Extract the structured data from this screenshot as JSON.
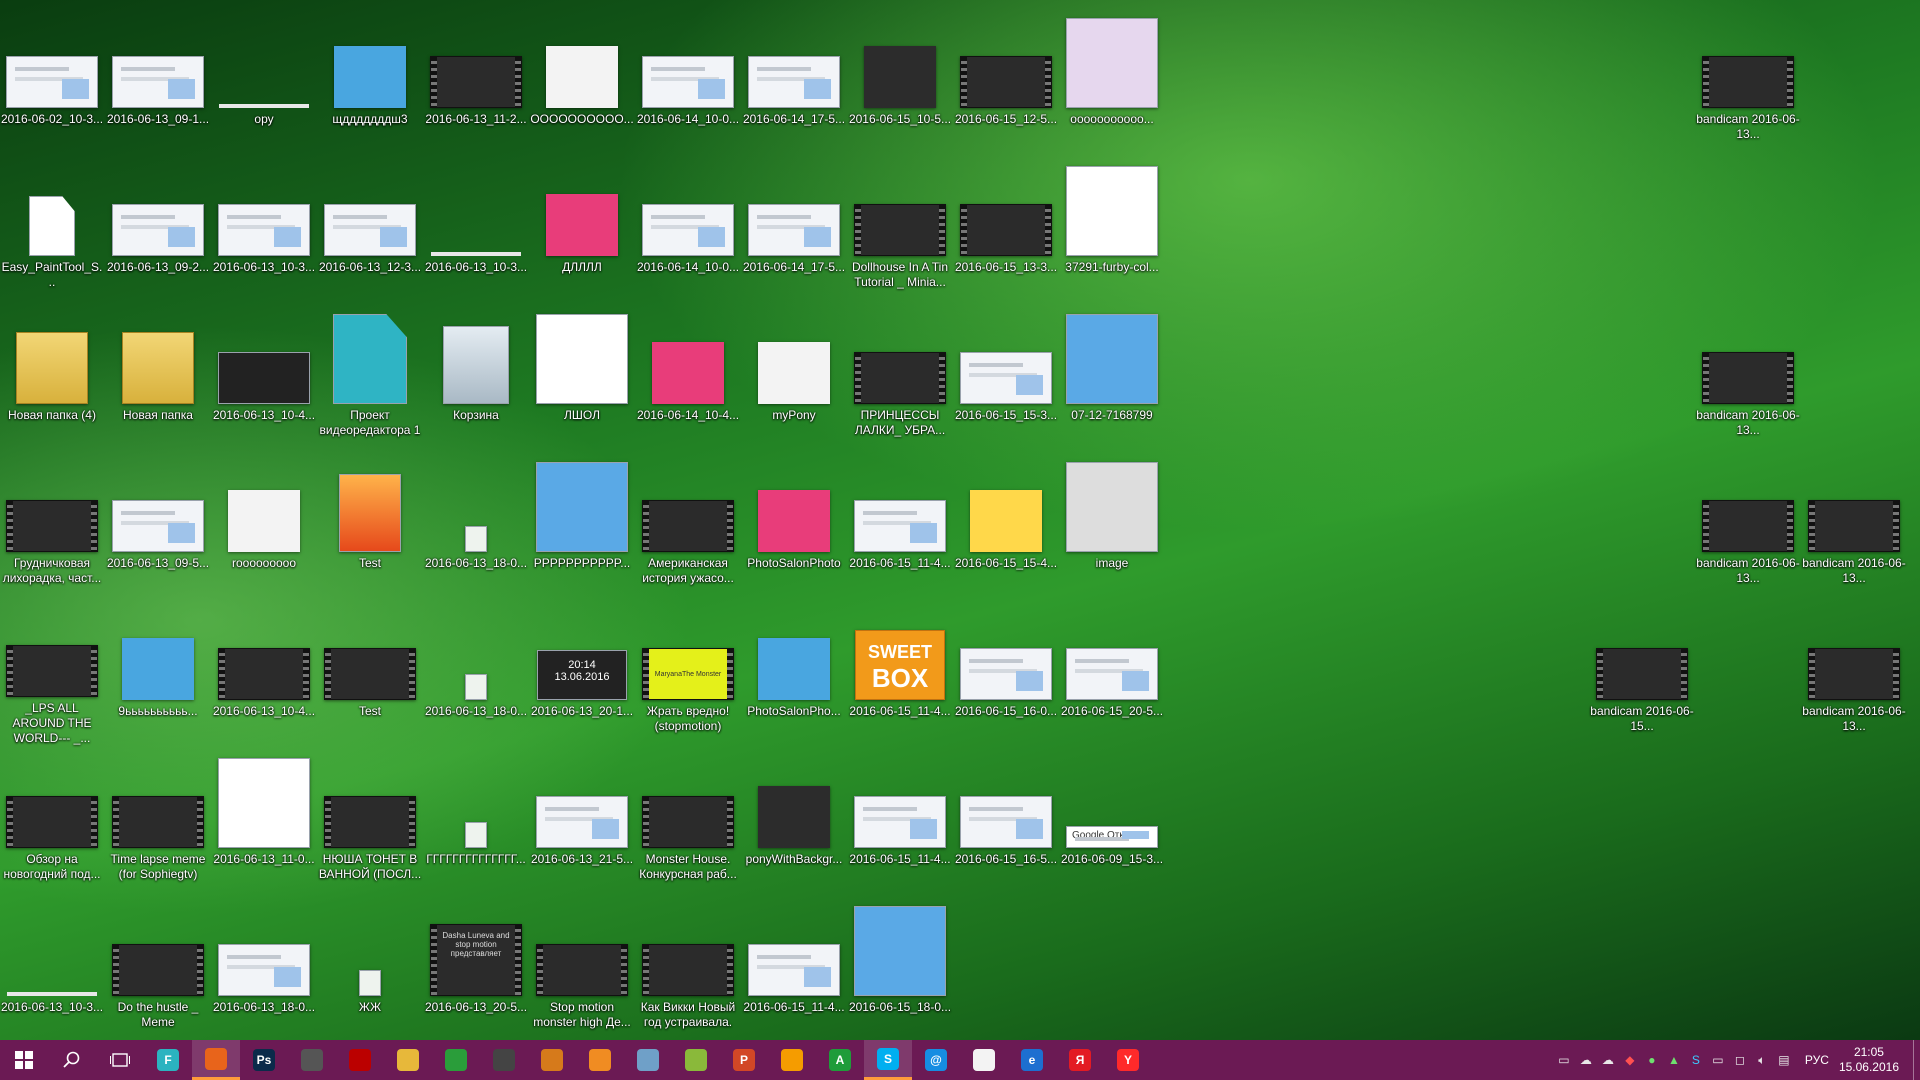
{
  "desktop_icons": [
    {
      "label": "2016-06-02_10-3...",
      "type": "shot"
    },
    {
      "label": "2016-06-13_09-1...",
      "type": "shot"
    },
    {
      "label": "ору",
      "type": "none"
    },
    {
      "label": "щдддддддш3",
      "type": "image"
    },
    {
      "label": "2016-06-13_11-2...",
      "type": "video"
    },
    {
      "label": "ОООООООООО...",
      "type": "image"
    },
    {
      "label": "2016-06-14_10-0...",
      "type": "shot"
    },
    {
      "label": "2016-06-14_17-5...",
      "type": "shot"
    },
    {
      "label": "2016-06-15_10-5...",
      "type": "image"
    },
    {
      "label": "2016-06-15_12-5...",
      "type": "video"
    },
    {
      "label": "ооооооооооо...",
      "type": "tall"
    },
    {
      "label": "Easy_PaintTool_S...",
      "type": "file"
    },
    {
      "label": "2016-06-13_09-2...",
      "type": "shot"
    },
    {
      "label": "2016-06-13_10-3...",
      "type": "shot"
    },
    {
      "label": "2016-06-13_12-3...",
      "type": "shot"
    },
    {
      "label": "2016-06-13_10-3...",
      "type": "none"
    },
    {
      "label": "ДЛЛЛЛ",
      "type": "image"
    },
    {
      "label": "2016-06-14_10-0...",
      "type": "shot"
    },
    {
      "label": "2016-06-14_17-5...",
      "type": "shot"
    },
    {
      "label": "Dollhouse In A Tin Tutorial _ Minia...",
      "type": "video"
    },
    {
      "label": "2016-06-15_13-3...",
      "type": "video"
    },
    {
      "label": "37291-furby-col...",
      "type": "tall"
    },
    {
      "label": "Новая папка (4)",
      "type": "folder"
    },
    {
      "label": "Новая папка",
      "type": "folder"
    },
    {
      "label": "2016-06-13_10-4...",
      "type": "dark"
    },
    {
      "label": "Проект видеоредактора 1",
      "type": "file"
    },
    {
      "label": "Корзина",
      "type": "bin"
    },
    {
      "label": "ЛШОЛ",
      "type": "tall"
    },
    {
      "label": "2016-06-14_10-4...",
      "type": "image"
    },
    {
      "label": "myPony",
      "type": "image"
    },
    {
      "label": "ПРИНЦЕССЫ ЛАЛКИ_ УБРА...",
      "type": "video"
    },
    {
      "label": "2016-06-15_15-3...",
      "type": "shot"
    },
    {
      "label": "07-12-7168799",
      "type": "tall"
    },
    {
      "label": "Грудничковая лихорадка, част...",
      "type": "video"
    },
    {
      "label": "2016-06-13_09-5...",
      "type": "shot"
    },
    {
      "label": "rooooooooo",
      "type": "image"
    },
    {
      "label": "Test",
      "type": "firefox"
    },
    {
      "label": "2016-06-13_18-0...",
      "type": "small"
    },
    {
      "label": "PPPPPPPPPPP...",
      "type": "tall"
    },
    {
      "label": "Американская история ужасо...",
      "type": "video"
    },
    {
      "label": "PhotoSalonPhoto",
      "type": "image"
    },
    {
      "label": "2016-06-15_11-4...",
      "type": "shot"
    },
    {
      "label": "2016-06-15_15-4...",
      "type": "image"
    },
    {
      "label": "image",
      "type": "tall"
    },
    {
      "label": "_LPS ALL AROUND THE WORLD--- _...",
      "type": "video"
    },
    {
      "label": "9ьььььььььь...",
      "type": "image"
    },
    {
      "label": "2016-06-13_10-4...",
      "type": "video"
    },
    {
      "label": "Test",
      "type": "video"
    },
    {
      "label": "2016-06-13_18-0...",
      "type": "small"
    },
    {
      "label": "2016-06-13_20-1...",
      "type": "dark"
    },
    {
      "label": "Жрать вредно! (stopmotion)",
      "type": "video"
    },
    {
      "label": "PhotoSalonPho...",
      "type": "image"
    },
    {
      "label": "2016-06-15_11-4...",
      "type": "sweetbox"
    },
    {
      "label": "2016-06-15_16-0...",
      "type": "shot"
    },
    {
      "label": "2016-06-15_20-5...",
      "type": "shot"
    },
    {
      "label": "Обзор на новогодний под...",
      "type": "video"
    },
    {
      "label": "Time lapse meme (for Sophiegtv)",
      "type": "video"
    },
    {
      "label": "2016-06-13_11-0...",
      "type": "tall"
    },
    {
      "label": "НЮША ТОНЕТ В ВАННОЙ (ПОСЛ...",
      "type": "video"
    },
    {
      "label": "ГГГГГГГГГГГГГГ...",
      "type": "small"
    },
    {
      "label": "2016-06-13_21-5...",
      "type": "shot"
    },
    {
      "label": "Monster House. Конкурсная раб...",
      "type": "video"
    },
    {
      "label": "ponyWithBackgr...",
      "type": "image"
    },
    {
      "label": "2016-06-15_11-4...",
      "type": "shot"
    },
    {
      "label": "2016-06-15_16-5...",
      "type": "shot"
    },
    {
      "label": "2016-06-09_15-3...",
      "type": "shot"
    },
    {
      "label": "2016-06-13_10-3...",
      "type": "none"
    },
    {
      "label": "Do the hustle _ Meme",
      "type": "video"
    },
    {
      "label": "2016-06-13_18-0...",
      "type": "shot"
    },
    {
      "label": "ЖЖ",
      "type": "small"
    },
    {
      "label": "2016-06-13_20-5...",
      "type": "video"
    },
    {
      "label": "Stop motion monster high Де...",
      "type": "video"
    },
    {
      "label": "Как Викки Новый год устраивала.",
      "type": "video"
    },
    {
      "label": "2016-06-15_11-4...",
      "type": "shot"
    },
    {
      "label": "2016-06-15_18-0...",
      "type": "tall"
    },
    {
      "label": "bandicam 2016-06-13...",
      "type": "video"
    },
    {
      "label": "bandicam 2016-06-13...",
      "type": "video"
    },
    {
      "label": "bandicam 2016-06-13...",
      "type": "video"
    },
    {
      "label": "bandicam 2016-06-13...",
      "type": "video"
    },
    {
      "label": "bandicam 2016-06-15...",
      "type": "video"
    },
    {
      "label": "bandicam 2016-06-13...",
      "type": "video"
    }
  ],
  "thumb_texts": {
    "google_otkliki": "Google Отклики",
    "date_time": "20:14",
    "date_date": "13.06.2016",
    "sweet": "SWEET",
    "box": "BOX",
    "dasha": "Dasha Luneva and stop motion представляет",
    "maryana": "MaryanaThe Monster"
  },
  "taskbar": {
    "apps": [
      {
        "name": "filmora",
        "glyph": "F",
        "color": "#2bb3c0"
      },
      {
        "name": "firefox",
        "glyph": "",
        "color": "#e8641b",
        "active": true
      },
      {
        "name": "photoshop",
        "glyph": "Ps",
        "color": "#0b2a4a"
      },
      {
        "name": "chrome-dev",
        "glyph": "",
        "color": "#555"
      },
      {
        "name": "recorder",
        "glyph": "",
        "color": "#b00"
      },
      {
        "name": "file-explorer",
        "glyph": "",
        "color": "#e7b83a"
      },
      {
        "name": "chrome",
        "glyph": "",
        "color": "#2a9d3a"
      },
      {
        "name": "store",
        "glyph": "",
        "color": "#444"
      },
      {
        "name": "movies",
        "glyph": "",
        "color": "#d67a1b"
      },
      {
        "name": "orange-app",
        "glyph": "",
        "color": "#f08c22"
      },
      {
        "name": "bird-app",
        "glyph": "",
        "color": "#6fa0c8"
      },
      {
        "name": "plants-game",
        "glyph": "",
        "color": "#8ab93a"
      },
      {
        "name": "powerpoint",
        "glyph": "P",
        "color": "#d24726"
      },
      {
        "name": "avast",
        "glyph": "",
        "color": "#f59c00"
      },
      {
        "name": "a-app",
        "glyph": "A",
        "color": "#1f9c3a"
      },
      {
        "name": "skype",
        "glyph": "S",
        "color": "#00aff0",
        "active": true
      },
      {
        "name": "mail-ru",
        "glyph": "@",
        "color": "#168de2"
      },
      {
        "name": "music-app",
        "glyph": "",
        "color": "#f3f3f3"
      },
      {
        "name": "edge",
        "glyph": "e",
        "color": "#1d6fd0"
      },
      {
        "name": "yandex",
        "glyph": "Я",
        "color": "#e31b23"
      },
      {
        "name": "yandex-browser",
        "glyph": "Y",
        "color": "#ff2a2a"
      }
    ],
    "tray": {
      "language": "РУС",
      "time": "21:05",
      "date": "15.06.2016"
    }
  },
  "colors": {
    "taskbar": "#6b1a54",
    "accent": "#ff9b3a"
  }
}
